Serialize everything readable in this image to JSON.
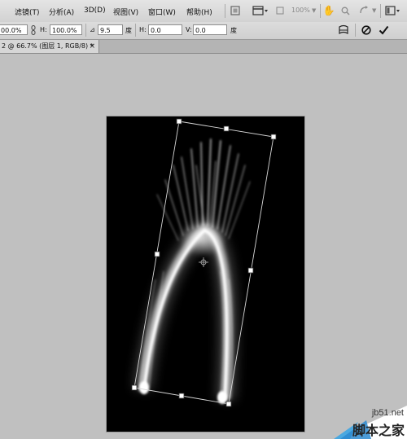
{
  "menubar": {
    "items": [
      "滤镜(T)",
      "分析(A)",
      "3D(D)",
      "视图(V)",
      "窗口(W)",
      "帮助(H)"
    ],
    "zoom": "100%"
  },
  "options": {
    "width_value": "00.0%",
    "height_label": "H:",
    "height_value": "100.0%",
    "angle_value": "9.5",
    "angle_unit": "度",
    "hskew_label": "H:",
    "hskew_value": "0.0",
    "hskew_unit": "度",
    "vskew_label": "V:",
    "vskew_value": "0.0",
    "vskew_unit": "度"
  },
  "document_tab": {
    "title": "2 @ 66.7% (图层 1, RGB/8) *",
    "close": "×"
  },
  "watermark": {
    "site": "jb51.net",
    "name": "脚本之家"
  },
  "colors": {
    "ui_gray": "#c0c0c0",
    "canvas": "#000000",
    "watermark_blue": "#4aa8e0"
  }
}
